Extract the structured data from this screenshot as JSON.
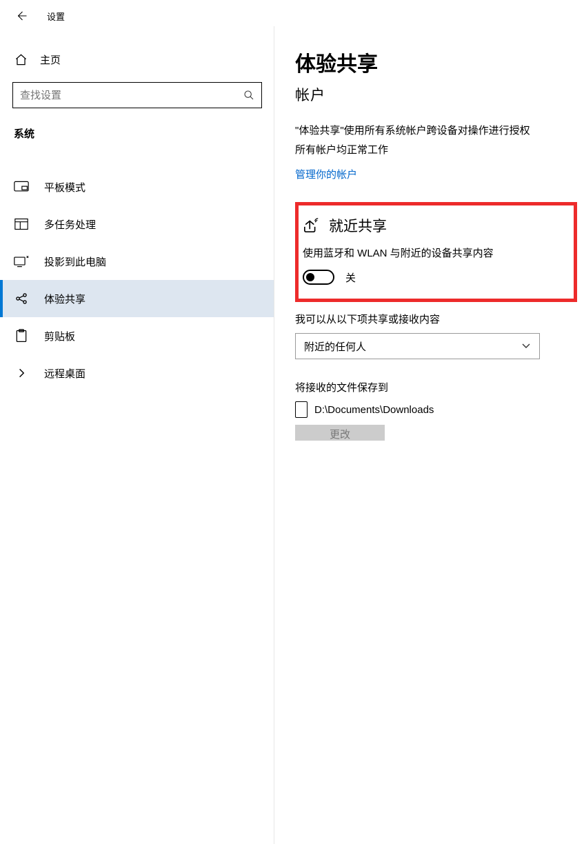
{
  "topbar": {
    "title": "设置"
  },
  "sidebar": {
    "home": "主页",
    "search_placeholder": "查找设置",
    "category": "系统",
    "items": [
      {
        "label": "平板模式"
      },
      {
        "label": "多任务处理"
      },
      {
        "label": "投影到此电脑"
      },
      {
        "label": "体验共享"
      },
      {
        "label": "剪贴板"
      },
      {
        "label": "远程桌面"
      }
    ]
  },
  "main": {
    "title": "体验共享",
    "subhead": "帐户",
    "desc1": "\"体验共享\"使用所有系统帐户跨设备对操作进行授权",
    "desc2": "所有帐户均正常工作",
    "link": "管理你的帐户",
    "nearby": {
      "heading": "就近共享",
      "desc": "使用蓝牙和 WLAN 与附近的设备共享内容",
      "toggle_state": "关"
    },
    "share_from_label": "我可以从以下项共享或接收内容",
    "share_from_value": "附近的任何人",
    "save_to_label": "将接收的文件保存到",
    "save_to_path": "D:\\Documents\\Downloads",
    "change_button": "更改"
  }
}
